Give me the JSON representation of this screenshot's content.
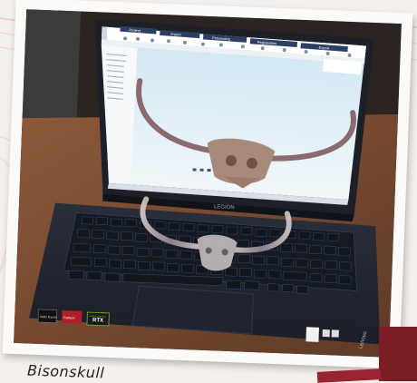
{
  "caption": "Bisonskull",
  "laptop": {
    "brand_label": "LEGION",
    "side_brand": "Lenovo"
  },
  "software": {
    "tabs": [
      "Project",
      "Import",
      "Processing",
      "Registration",
      "Export"
    ]
  },
  "stickers": [
    "AMD Ryzen",
    "Radeon",
    "RTX",
    "NVIDIA GeForce"
  ]
}
